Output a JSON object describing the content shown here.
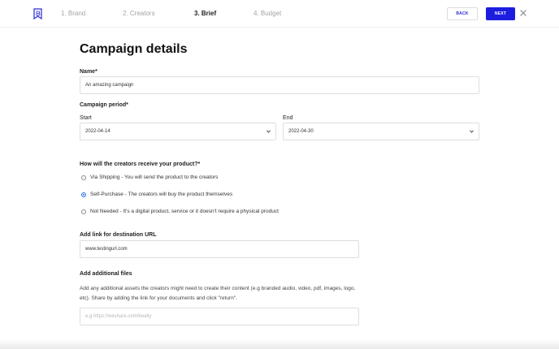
{
  "header": {
    "steps": [
      {
        "label": "1. Brand",
        "active": false
      },
      {
        "label": "2. Creators",
        "active": false
      },
      {
        "label": "3. Brief",
        "active": true
      },
      {
        "label": "4. Budget",
        "active": false
      }
    ],
    "back_label": "BACK",
    "next_label": "NEXT",
    "logo_icon": "bookmark-logo-icon",
    "close_icon": "close-icon"
  },
  "main": {
    "title": "Campaign details",
    "name": {
      "label": "Name*",
      "value": "An amazing campaign"
    },
    "period": {
      "label": "Campaign period*",
      "start": {
        "label": "Start",
        "value": "2022-04-14"
      },
      "end": {
        "label": "End",
        "value": "2022-04-30"
      }
    },
    "product": {
      "question": "How will the creators receive your product?*",
      "options": [
        {
          "label": "Via Shipping - You will send the product to the creators",
          "checked": false
        },
        {
          "label": "Self-Purchase - The creators will buy the product themselves",
          "checked": true
        },
        {
          "label": "Not Needed - It's a digital product, service or it doesn't require a physical product",
          "checked": false
        }
      ]
    },
    "destination_url": {
      "label": "Add link for destination URL",
      "value": "www.testingurl.com"
    },
    "files": {
      "label": "Add additional files",
      "description": "Add any additional assets the creators might need to create their content (e.g branded audio, video, pdf, images, logo, etc). Share by adding the link for your documents and click \"return\".",
      "placeholder": "e.g https://weshare.com/beatly"
    }
  },
  "colors": {
    "accent": "#1d1de0",
    "radio_checked": "#1d6fe8"
  }
}
